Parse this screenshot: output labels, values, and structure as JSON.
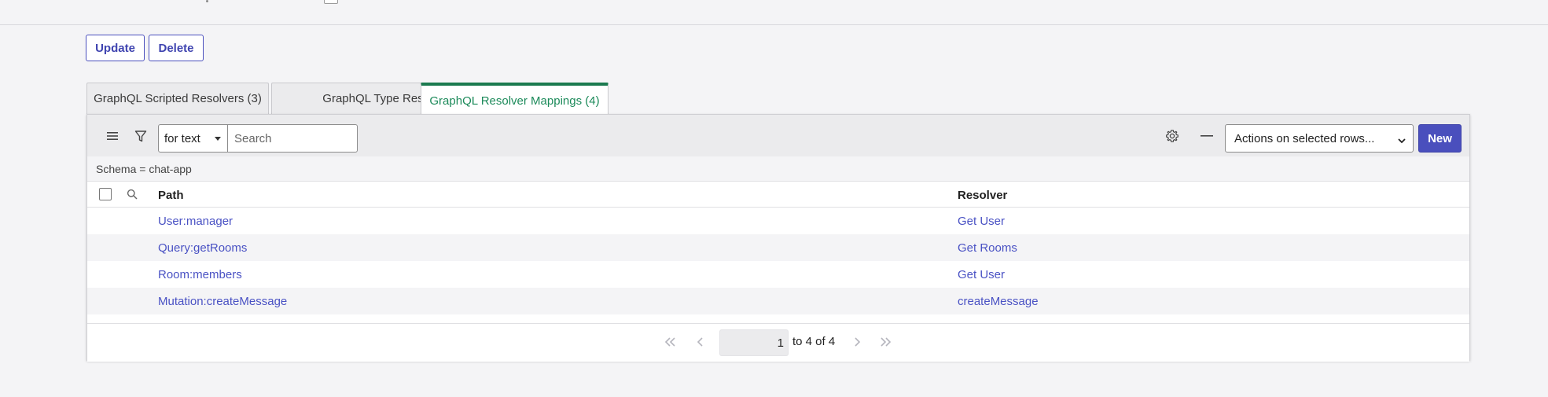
{
  "buttons": {
    "update": "Update",
    "delete": "Delete"
  },
  "tabs": [
    {
      "label": "GraphQL Scripted Resolvers (3)",
      "active": false
    },
    {
      "label": "GraphQL Type Resolvers",
      "active": false
    },
    {
      "label": "GraphQL Resolver Mappings (4)",
      "active": true
    }
  ],
  "toolbar": {
    "search_field_option": "for text",
    "search_placeholder": "Search",
    "actions_label": "Actions on selected rows...",
    "new_label": "New"
  },
  "breadcrumb": "Schema = chat-app",
  "table": {
    "columns": [
      "Path",
      "Resolver"
    ],
    "rows": [
      {
        "path": "User:manager",
        "resolver": "Get User"
      },
      {
        "path": "Query:getRooms",
        "resolver": "Get Rooms"
      },
      {
        "path": "Room:members",
        "resolver": "Get User"
      },
      {
        "path": "Mutation:createMessage",
        "resolver": "createMessage"
      }
    ]
  },
  "pagination": {
    "current_page": "1",
    "range_text": "to 4 of 4"
  },
  "colors": {
    "primary": "#4a4fbd",
    "link": "#4a52c4",
    "active_tab": "#1b7a4f"
  },
  "icons": [
    "list-icon",
    "filter-icon",
    "caret-down-icon",
    "search-icon",
    "gear-icon",
    "minus-icon",
    "chevron-down-icon",
    "first-page-icon",
    "prev-page-icon",
    "next-page-icon",
    "last-page-icon"
  ]
}
